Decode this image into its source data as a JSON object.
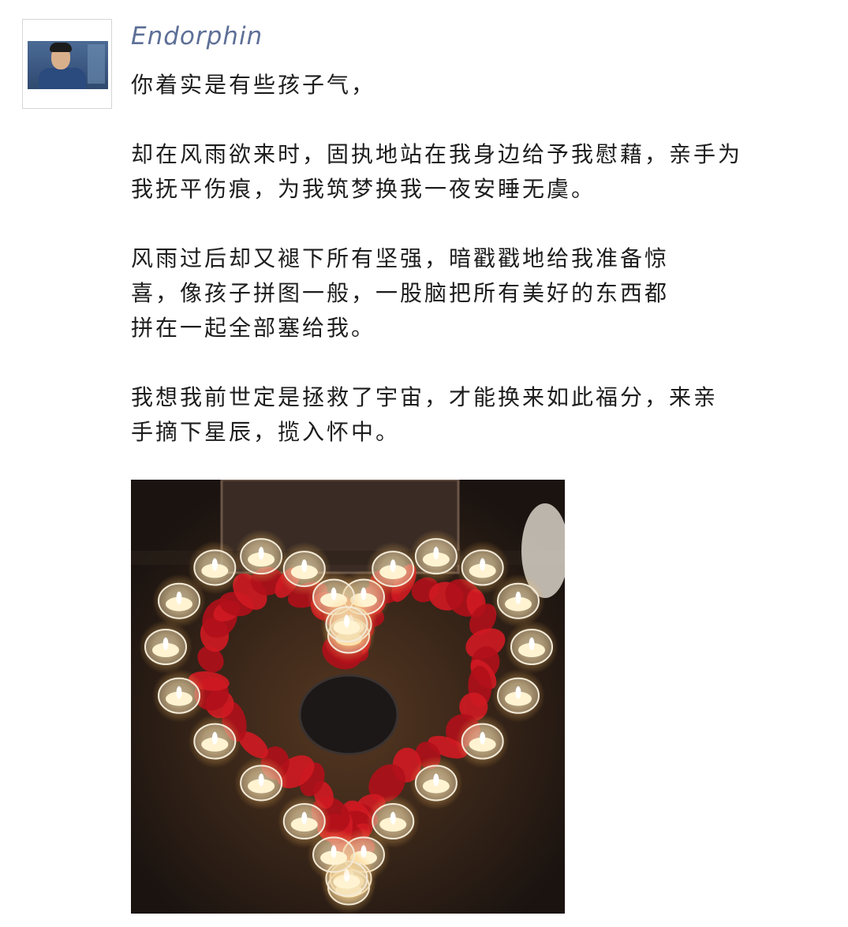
{
  "post": {
    "author": "Endorphin",
    "paragraphs": [
      "你着实是有些孩子气，",
      "却在风雨欲来时，固执地站在我身边给予我慰藉，亲手为\n我抚平伤痕，为我筑梦换我一夜安睡无虞。",
      "风雨过后却又褪下所有坚强，暗戳戳地给我准备惊\n喜，像孩子拼图一般，一股脑把所有美好的东西都\n拼在一起全部塞给我。",
      "我想我前世定是拯救了宇宙，才能换来如此福分，来亲\n手摘下星辰，揽入怀中。"
    ]
  },
  "colors": {
    "username": "#5d6f97",
    "text": "#1d1d1d",
    "photo_bg": "#2a1f1a",
    "petals": "#b0101a",
    "candle_glow": "#ffe7a8"
  }
}
